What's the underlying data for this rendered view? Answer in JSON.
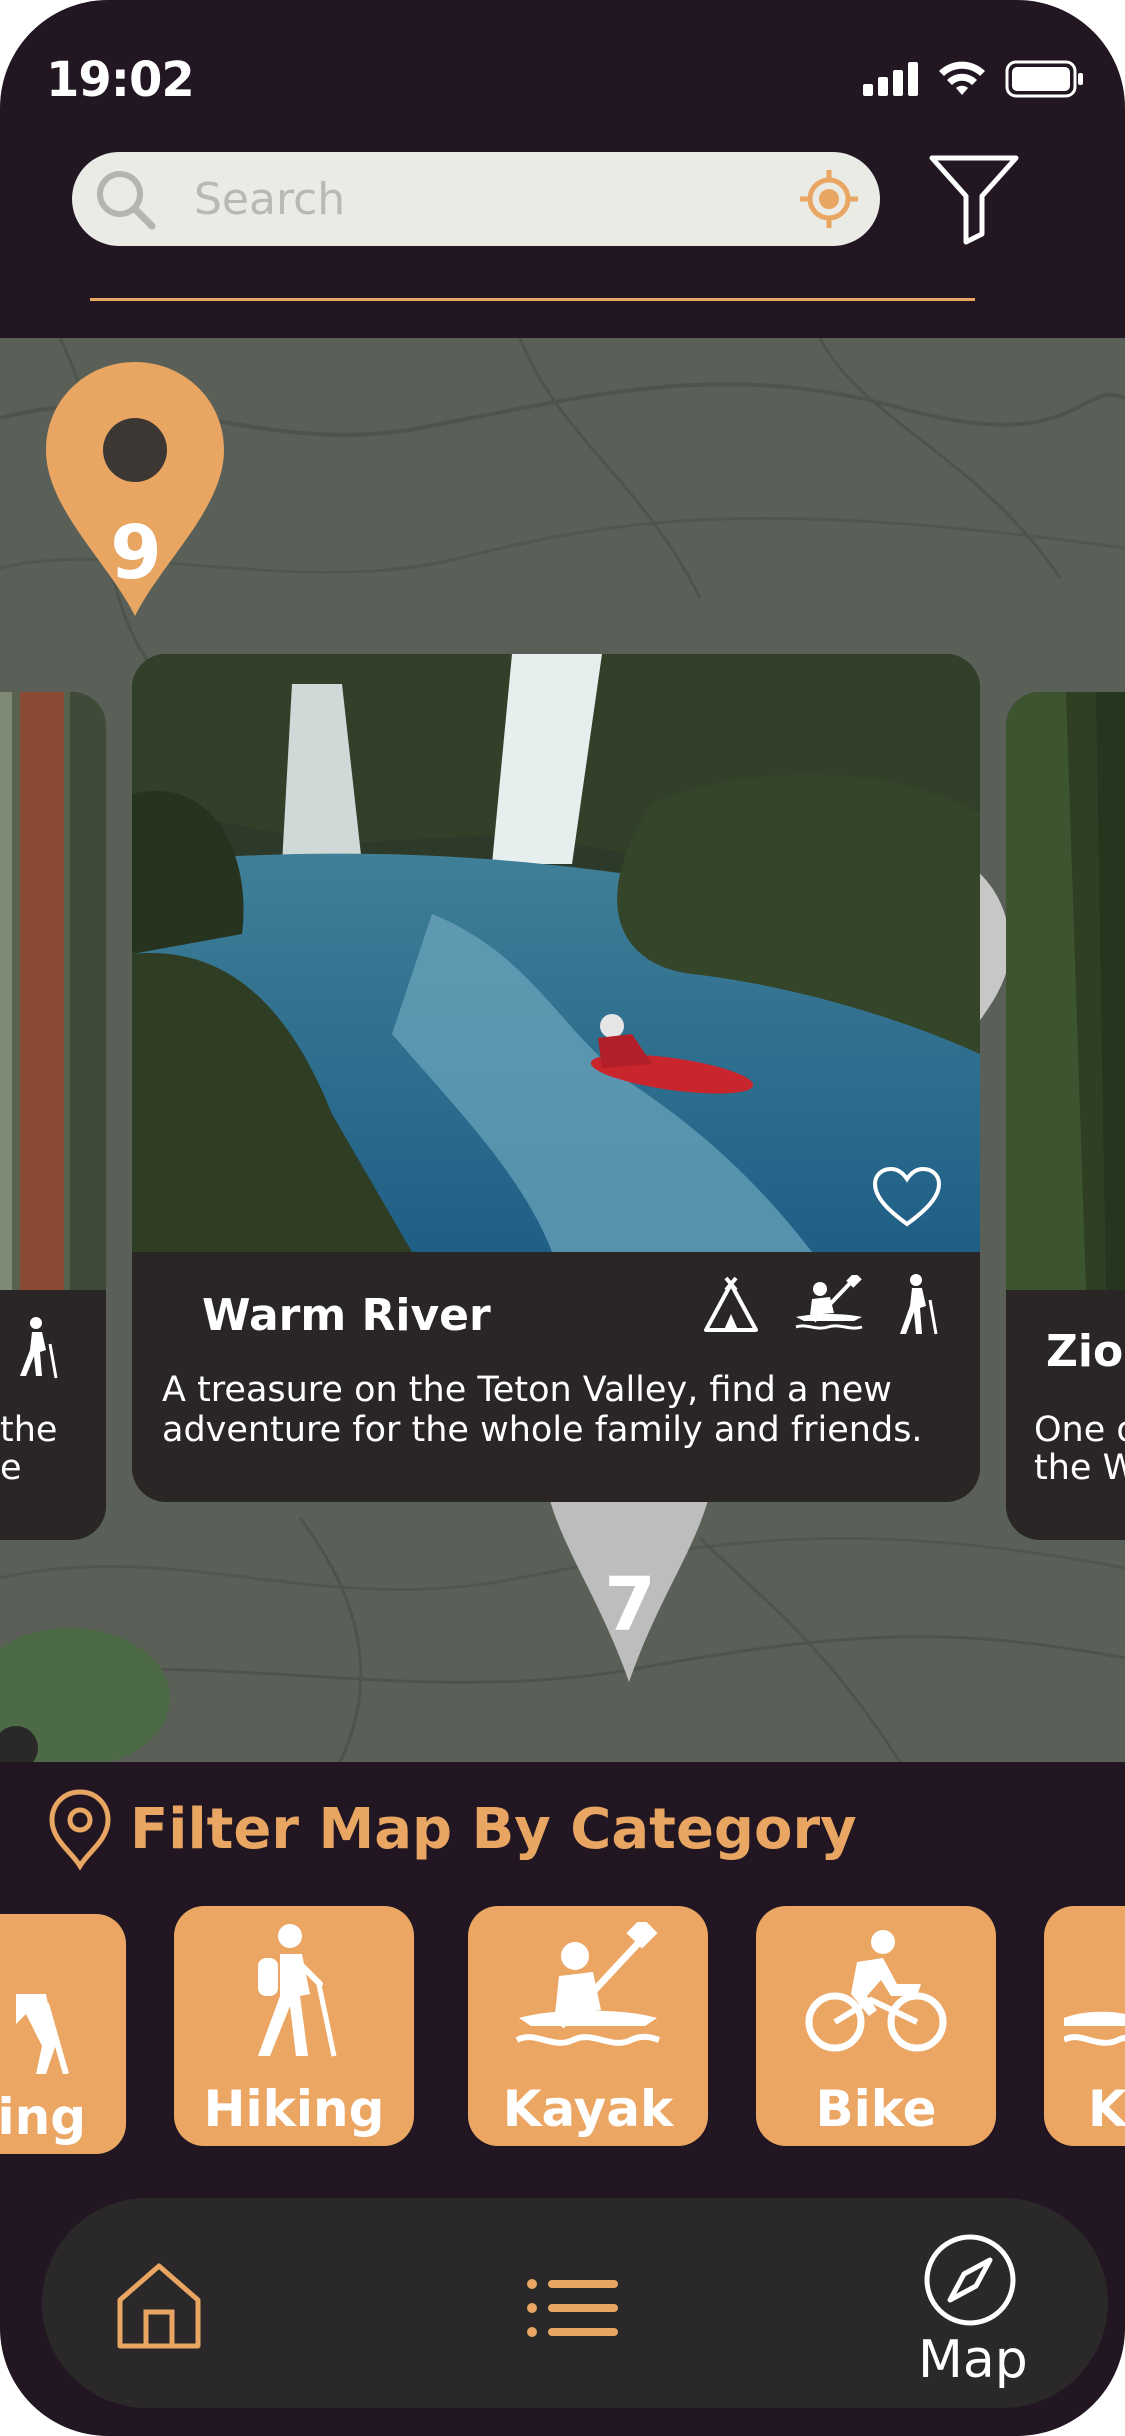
{
  "status": {
    "time": "19:02"
  },
  "search": {
    "placeholder": "Search"
  },
  "map": {
    "markers": [
      {
        "label": "9",
        "color": "#e8a662"
      },
      {
        "label": "7",
        "color": "#bdbdbd"
      }
    ]
  },
  "cards": {
    "main": {
      "title": "Warm River",
      "description": "A treasure on the Teton Valley, find a new adventure for the whole family and friends.",
      "activities": [
        "camping-icon",
        "kayak-icon",
        "hiking-icon"
      ]
    },
    "left": {
      "desc_line1": "the",
      "desc_line2": "e"
    },
    "right": {
      "title": "Zion",
      "desc_line1": "One o",
      "desc_line2": "the W"
    }
  },
  "filter": {
    "title": "Filter Map By Category",
    "categories": [
      {
        "label": "ing"
      },
      {
        "label": "Hiking"
      },
      {
        "label": "Kayak"
      },
      {
        "label": "Bike"
      },
      {
        "label": "K"
      }
    ]
  },
  "tabbar": {
    "tabs": [
      {
        "name": "home-icon"
      },
      {
        "name": "list-icon"
      },
      {
        "name": "compass-icon",
        "label": "Map"
      }
    ]
  },
  "colors": {
    "accent": "#e8a662",
    "background": "#211622",
    "card": "#2a2626",
    "map": "#5c6259"
  }
}
